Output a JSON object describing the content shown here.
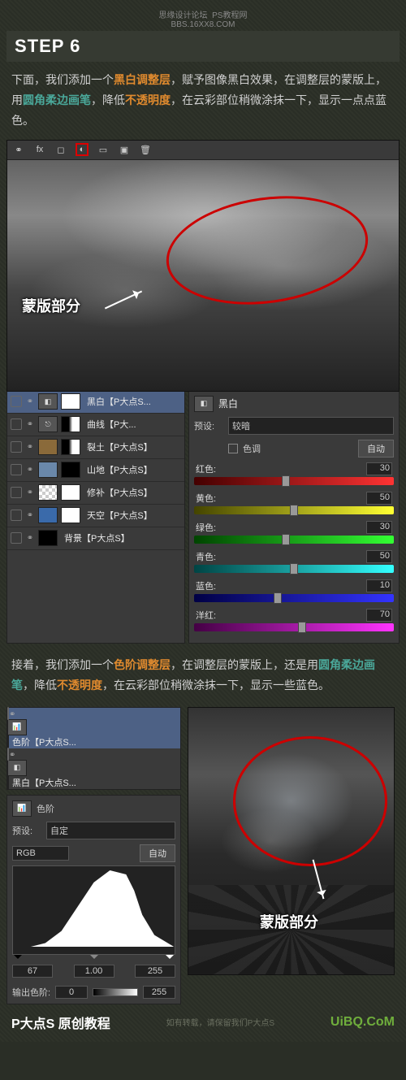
{
  "credits": {
    "forum": "思缘设计论坛",
    "site": "PS教程网",
    "url": "BBS.16XX8.COM"
  },
  "step": {
    "title": "STEP 6"
  },
  "p1": {
    "t1": "下面，我们添加一个",
    "bw": "黑白调整层",
    "t2": "，赋予图像黑白效果，在调整层的蒙版上，用",
    "brush": "圆角柔边画笔",
    "t3": "，降低",
    "opac": "不透明度",
    "t4": "，在云彩部位稍微涂抹一下，显示一点点蓝色。"
  },
  "mask_label": "蒙版部分",
  "layers1": [
    {
      "name": "黑白【P大点S...",
      "sel": true,
      "adj": "bw",
      "mask": "white"
    },
    {
      "name": "曲线【P大...",
      "adj": "curve",
      "mask": "dark"
    },
    {
      "name": "裂土【P大点S】",
      "img": "#8a6a3a",
      "mask": "dark"
    },
    {
      "name": "山地【P大点S】",
      "img": "#6a88aa",
      "mask": "black"
    },
    {
      "name": "修补【P大点S】",
      "img": "checker",
      "mask": "white"
    },
    {
      "name": "天空【P大点S】",
      "img": "#3a6aaa",
      "mask": "white"
    },
    {
      "name": "背景【P大点S】",
      "img": "#000"
    }
  ],
  "bw": {
    "title": "黑白",
    "preset_label": "预设:",
    "preset": "较暗",
    "tint": "色调",
    "auto": "自动",
    "sliders": [
      {
        "label": "红色:",
        "val": 30,
        "grad": [
          "#400",
          "#f33"
        ]
      },
      {
        "label": "黄色:",
        "val": 50,
        "grad": [
          "#440",
          "#ff3"
        ]
      },
      {
        "label": "绿色:",
        "val": 30,
        "grad": [
          "#040",
          "#3f3"
        ]
      },
      {
        "label": "青色:",
        "val": 50,
        "grad": [
          "#044",
          "#3ff"
        ]
      },
      {
        "label": "蓝色:",
        "val": 10,
        "grad": [
          "#004",
          "#33f"
        ]
      },
      {
        "label": "洋红:",
        "val": 70,
        "grad": [
          "#404",
          "#f3f"
        ]
      }
    ]
  },
  "p2": {
    "t1": "接着，我们添加一个",
    "lv": "色阶调整层",
    "t2": "，在调整层的蒙版上，还是用",
    "brush": "圆角柔边画笔",
    "t3": "，降低",
    "opac": "不透明度",
    "t4": "，在云彩部位稍微涂抹一下，显示一些蓝色。"
  },
  "layers2": [
    {
      "name": "色阶【P大点S...",
      "sel": true,
      "adj": "lv",
      "mask": "white"
    },
    {
      "name": "黑白【P大点S...",
      "adj": "bw",
      "mask": "white"
    }
  ],
  "levels": {
    "title": "色阶",
    "preset_label": "预设:",
    "preset": "自定",
    "channel": "RGB",
    "auto": "自动",
    "in": [
      "67",
      "1.00",
      "255"
    ],
    "out_label": "输出色阶:",
    "out": [
      "0",
      "255"
    ]
  },
  "footer": {
    "brand": "P大点S 原创教程",
    "note": "如有转载，请保留我们P大点S",
    "wm": "UiBQ.CoM"
  }
}
